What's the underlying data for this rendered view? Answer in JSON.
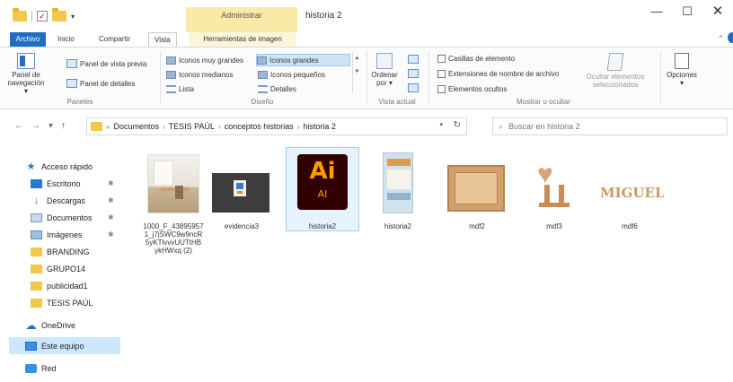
{
  "window": {
    "title": "historia 2",
    "context_group": "Administrar",
    "controls": {
      "minimize": "—",
      "maximize": "☐",
      "close": "✕"
    }
  },
  "tabs": [
    {
      "label": "Archivo"
    },
    {
      "label": "Inicio"
    },
    {
      "label": "Compartir"
    },
    {
      "label": "Vista"
    },
    {
      "label": "Herramientas de imagen"
    }
  ],
  "ribbon": {
    "paneles": {
      "label": "Paneles",
      "nav_pane_line1": "Panel de",
      "nav_pane_line2": "navegación ▾",
      "preview_pane": "Panel de vista previa",
      "details_pane": "Panel de detalles"
    },
    "diseno": {
      "label": "Diseño",
      "items": {
        "extra_large": "Iconos muy grandes",
        "large": "Iconos grandes",
        "medium": "Iconos medianos",
        "small": "Iconos pequeños",
        "list": "Lista",
        "details": "Detalles"
      }
    },
    "vista_actual": {
      "label": "Vista actual",
      "sort_line1": "Ordenar",
      "sort_line2": "por ▾"
    },
    "mostrar": {
      "label": "Mostrar u ocultar",
      "item_checkboxes": "Casillas de elemento",
      "extensions": "Extensiones de nombre de archivo",
      "hidden_items": "Elementos ocultos",
      "hide_selected_line1": "Ocultar elementos",
      "hide_selected_line2": "seleccionados"
    },
    "opciones": {
      "label": "Opciones"
    }
  },
  "address": {
    "prefix": "«",
    "crumbs": [
      "Documentos",
      "TESIS PAÚL",
      "conceptos historias",
      "historia 2"
    ],
    "separator": "›"
  },
  "search": {
    "placeholder": "Buscar en historia 2"
  },
  "nav_pane": {
    "items": [
      {
        "label": "Acceso rápido"
      },
      {
        "label": "Escritorio"
      },
      {
        "label": "Descargas"
      },
      {
        "label": "Documentos"
      },
      {
        "label": "Imágenes"
      },
      {
        "label": "BRANDING"
      },
      {
        "label": "GRUPO14"
      },
      {
        "label": "publicidad1"
      },
      {
        "label": "TESIS PAÚL"
      },
      {
        "label": "OneDrive"
      },
      {
        "label": "Este equipo"
      },
      {
        "label": "Red"
      }
    ]
  },
  "files": [
    {
      "name_lines": [
        "1000_F_43895957",
        "1_j7jSWC9w9ncR",
        "5yKTlvvvUUTtHB",
        "ykHWxq (2)"
      ]
    },
    {
      "name": "evidencia3"
    },
    {
      "name": "historia2",
      "ai_big": "Ai",
      "ai_small": "AI"
    },
    {
      "name": "historia2"
    },
    {
      "name": "mdf2"
    },
    {
      "name": "mdf3"
    },
    {
      "name": "mdf6",
      "thumb_text": "MIGUEL"
    }
  ],
  "colors": {
    "accent": "#1e6fc2",
    "context_tab": "#fbe9a8",
    "selection": "#cce8ff",
    "folder": "#f3c64d",
    "ai_bg": "#300000",
    "ai_fg": "#ff9a00"
  }
}
